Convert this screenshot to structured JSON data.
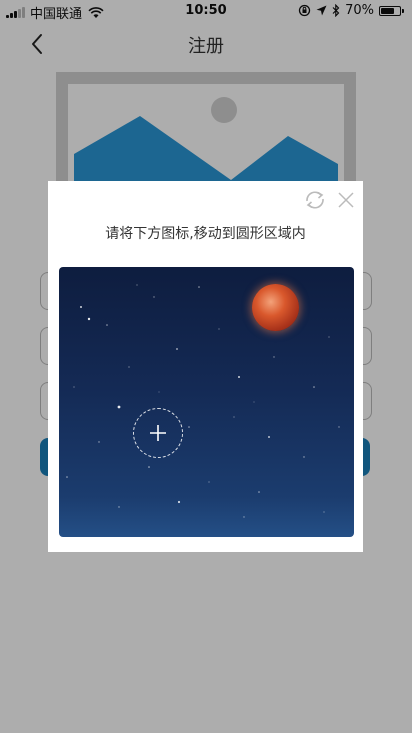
{
  "status_bar": {
    "carrier": "中国联通",
    "time": "10:50",
    "battery_percent": "70%",
    "battery_level": 0.7
  },
  "nav": {
    "title": "注册"
  },
  "captcha": {
    "instruction": "请将下方图标,移动到圆形区域内"
  },
  "icons": {
    "back": "chevron-left-icon",
    "refresh": "refresh-icon",
    "close": "close-icon",
    "wifi": "wifi-icon",
    "location": "location-arrow-icon",
    "bluetooth": "bluetooth-icon",
    "lock_rotation": "orientation-lock-icon"
  },
  "colors": {
    "accent": "#1a7fb8",
    "overlay": "rgba(0,0,0,0.32)",
    "sky": "#142a55",
    "moon": "#d9582c"
  }
}
